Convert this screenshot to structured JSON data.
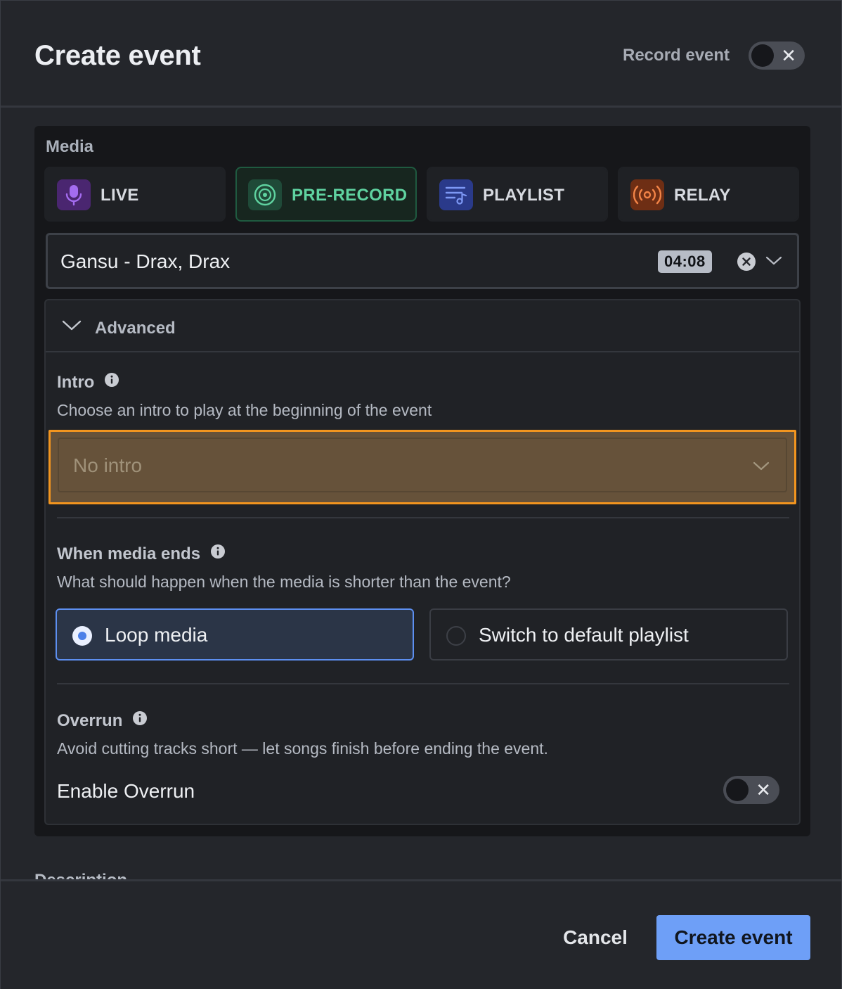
{
  "header": {
    "title": "Create event",
    "record_label": "Record event",
    "record_toggle_on": false
  },
  "media": {
    "label": "Media",
    "tabs": [
      {
        "label": "LIVE",
        "icon": "microphone-icon",
        "color": "#8f55e0",
        "bg": "#4a2670",
        "active": false
      },
      {
        "label": "PRE-RECORD",
        "icon": "vinyl-record-icon",
        "color": "#5fd2a0",
        "bg": "#1f4a38",
        "active": true
      },
      {
        "label": "PLAYLIST",
        "icon": "playlist-icon",
        "color": "#6e8cf2",
        "bg": "#2a3a8a",
        "active": false
      },
      {
        "label": "RELAY",
        "icon": "broadcast-icon",
        "color": "#f07a3a",
        "bg": "#6e2e14",
        "active": false
      }
    ],
    "selected_track": "Gansu - Drax, Drax",
    "duration": "04:08"
  },
  "advanced": {
    "title": "Advanced",
    "intro": {
      "title": "Intro",
      "description": "Choose an intro to play at the beginning of the event",
      "placeholder": "No intro"
    },
    "media_ends": {
      "title": "When media ends",
      "description": "What should happen when the media is shorter than the event?",
      "options": [
        {
          "label": "Loop media",
          "selected": true
        },
        {
          "label": "Switch to default playlist",
          "selected": false
        }
      ]
    },
    "overrun": {
      "title": "Overrun",
      "description": "Avoid cutting tracks short — let songs finish before ending the event.",
      "enable_label": "Enable Overrun",
      "enabled": false
    }
  },
  "description_label": "Description",
  "footer": {
    "cancel_label": "Cancel",
    "create_label": "Create event"
  },
  "colors": {
    "accent_blue": "#6e9ff7",
    "highlight_orange": "#f2951f"
  }
}
